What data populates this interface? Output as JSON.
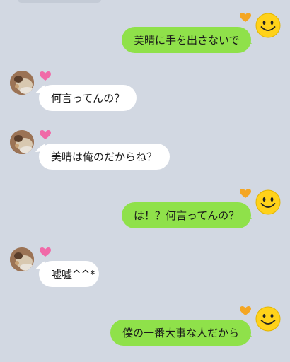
{
  "conversation": {
    "messages": [
      {
        "sender": "me",
        "text": "美晴に手を出さないで",
        "reaction": "orange-heart-icon"
      },
      {
        "sender": "them",
        "text": "何言ってんの？",
        "reaction": "pink-heart-icon"
      },
      {
        "sender": "them",
        "text": "美晴は俺のだからね？",
        "reaction": "pink-heart-icon"
      },
      {
        "sender": "me",
        "text": "は！？何言ってんの？",
        "reaction": "orange-heart-icon"
      },
      {
        "sender": "them",
        "text": "嘘嘘^^*",
        "reaction": "pink-heart-icon"
      },
      {
        "sender": "me",
        "text": "僕の一番大事な人だから",
        "reaction": "orange-heart-icon"
      }
    ]
  },
  "colors": {
    "background": "#d2d8e2",
    "my_bubble": "#8fe14a",
    "their_bubble": "#ffffff",
    "my_heart": "#f4a623",
    "their_heart": "#f06aa8",
    "smiley": "#ffd21a"
  }
}
